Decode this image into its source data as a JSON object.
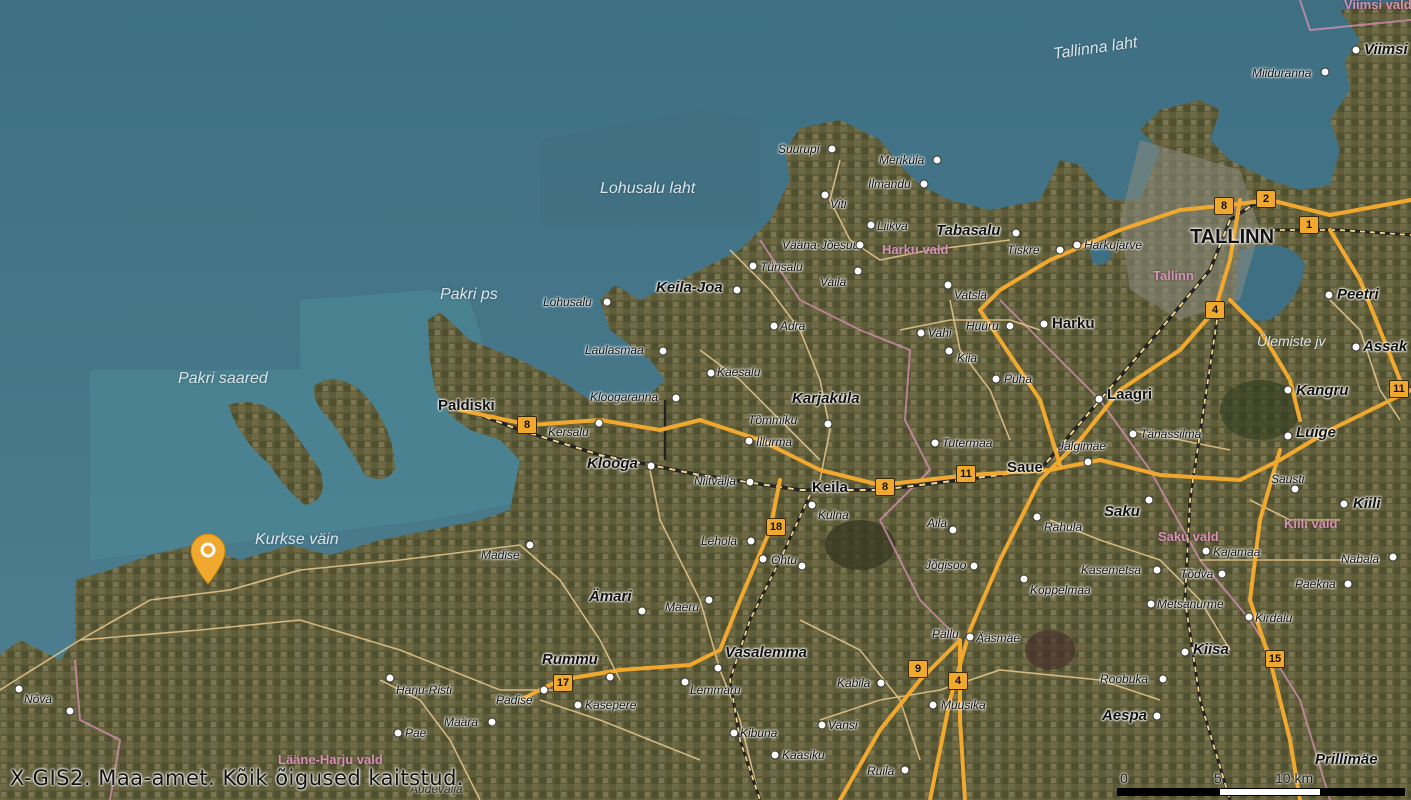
{
  "map": {
    "copyright": "X-GIS2. Maa-amet. Kõik õigused kaitstud.",
    "scale": {
      "labels": [
        "0",
        "5",
        "10 km"
      ]
    },
    "marker": {
      "color": "#f0a92e",
      "icon": "map-pin-icon"
    },
    "colors": {
      "sea": "#3f6d80",
      "land": "#5c5a3a",
      "road": "#f0a92e",
      "parish": "#d790b6"
    },
    "sea_labels": [
      {
        "id": "tallinna-laht",
        "text": "Tallinna laht"
      },
      {
        "id": "lohusalu-laht",
        "text": "Lohusalu laht"
      },
      {
        "id": "pakri-ps",
        "text": "Pakri ps"
      },
      {
        "id": "pakri-saared",
        "text": "Pakri saared"
      },
      {
        "id": "kurkse-vain",
        "text": "Kurkse väin"
      },
      {
        "id": "ulemiste-jv",
        "text": "Ülemiste jv"
      }
    ],
    "parish_labels": [
      {
        "id": "harku-vald",
        "text": "Harku vald"
      },
      {
        "id": "tallinn-area",
        "text": "Tallinn"
      },
      {
        "id": "saku-vald",
        "text": "Saku vald"
      },
      {
        "id": "kiili-vald",
        "text": "Kiili vald"
      },
      {
        "id": "laane-harju-vald",
        "text": "Lääne-Harju vald"
      },
      {
        "id": "viimsi-vald",
        "text": "Viimsi vald"
      }
    ],
    "capital": {
      "id": "tallinn",
      "text": "TALLINN"
    },
    "cities": [
      {
        "id": "paldiski",
        "text": "Paldiski"
      },
      {
        "id": "klooga",
        "text": "Klooga"
      },
      {
        "id": "keila-joa",
        "text": "Keila-Joa"
      },
      {
        "id": "karjakula",
        "text": "Karjaküla"
      },
      {
        "id": "keila",
        "text": "Keila"
      },
      {
        "id": "tabasalu",
        "text": "Tabasalu"
      },
      {
        "id": "harku",
        "text": "Harku"
      },
      {
        "id": "laagri",
        "text": "Laagri"
      },
      {
        "id": "saue",
        "text": "Saue"
      },
      {
        "id": "saku",
        "text": "Saku"
      },
      {
        "id": "kiisa",
        "text": "Kiisa"
      },
      {
        "id": "aespa",
        "text": "Aespa"
      },
      {
        "id": "rummu",
        "text": "Rummu"
      },
      {
        "id": "amari",
        "text": "Ämari"
      },
      {
        "id": "vasalemma",
        "text": "Vasalemma"
      },
      {
        "id": "kangru",
        "text": "Kangru"
      },
      {
        "id": "luige",
        "text": "Luige"
      },
      {
        "id": "kiili",
        "text": "Kiili"
      },
      {
        "id": "peetri",
        "text": "Peetri"
      },
      {
        "id": "assaku",
        "text": "Assak"
      },
      {
        "id": "viimsi",
        "text": "Viimsi"
      },
      {
        "id": "prillimae",
        "text": "Prillimäe"
      }
    ],
    "towns": [
      {
        "id": "suurupi",
        "text": "Suurupi"
      },
      {
        "id": "merikula",
        "text": "Meriküla"
      },
      {
        "id": "ilmandu",
        "text": "Ilmandu"
      },
      {
        "id": "viti",
        "text": "Viti"
      },
      {
        "id": "liikva",
        "text": "Liikva"
      },
      {
        "id": "vaana-joesuu",
        "text": "Vääna-Jõesuu"
      },
      {
        "id": "tiskre",
        "text": "Tiskre"
      },
      {
        "id": "harkujarve",
        "text": "Harkujärve"
      },
      {
        "id": "turisalu",
        "text": "Türisalu"
      },
      {
        "id": "vaila",
        "text": "Vaila"
      },
      {
        "id": "vatsla",
        "text": "Vatsla"
      },
      {
        "id": "lohusalu",
        "text": "Lohusalu"
      },
      {
        "id": "laulasmaa",
        "text": "Laulasmaa"
      },
      {
        "id": "adra",
        "text": "Adra"
      },
      {
        "id": "vahi",
        "text": "Vahi"
      },
      {
        "id": "huuru",
        "text": "Hüüru"
      },
      {
        "id": "kiia",
        "text": "Kiia"
      },
      {
        "id": "kaesalu",
        "text": "Käesalu"
      },
      {
        "id": "puha",
        "text": "Püha"
      },
      {
        "id": "kloogaranna",
        "text": "Kloogaranna"
      },
      {
        "id": "kersalu",
        "text": "Kersalu"
      },
      {
        "id": "tommiku",
        "text": "Tõmmiku"
      },
      {
        "id": "illurma",
        "text": "Illurma"
      },
      {
        "id": "tutermaa",
        "text": "Tutermaa"
      },
      {
        "id": "jalgimae",
        "text": "Jälgimäe"
      },
      {
        "id": "tanassilma",
        "text": "Tänassilma"
      },
      {
        "id": "niitvalja",
        "text": "Niitvälja"
      },
      {
        "id": "kulna",
        "text": "Kulna"
      },
      {
        "id": "aila",
        "text": "Aila"
      },
      {
        "id": "rahula",
        "text": "Rahula"
      },
      {
        "id": "sausti",
        "text": "Sausti"
      },
      {
        "id": "madise",
        "text": "Madise"
      },
      {
        "id": "lehola",
        "text": "Lehola"
      },
      {
        "id": "ohtu",
        "text": "Ohtu"
      },
      {
        "id": "jogisoo",
        "text": "Jõgisoo"
      },
      {
        "id": "kajamaa",
        "text": "Kajamaa"
      },
      {
        "id": "nabala",
        "text": "Nabala"
      },
      {
        "id": "kasemetsa",
        "text": "Kasemetsa"
      },
      {
        "id": "todva",
        "text": "Tõdva"
      },
      {
        "id": "paekna",
        "text": "Paekna"
      },
      {
        "id": "koppelmaa",
        "text": "Koppelmaa"
      },
      {
        "id": "maeru",
        "text": "Maeru"
      },
      {
        "id": "metsanurme",
        "text": "Metsanurme"
      },
      {
        "id": "kirdalu",
        "text": "Kirdalu"
      },
      {
        "id": "pallu",
        "text": "Pällu"
      },
      {
        "id": "aasmae",
        "text": "Ääsmäe"
      },
      {
        "id": "nova",
        "text": "Nõva"
      },
      {
        "id": "harju-risti",
        "text": "Harju-Risti"
      },
      {
        "id": "padise",
        "text": "Padise"
      },
      {
        "id": "kasepere",
        "text": "Kasepere"
      },
      {
        "id": "lemmaru",
        "text": "Lemmaru"
      },
      {
        "id": "kabila",
        "text": "Kabila"
      },
      {
        "id": "roobuka",
        "text": "Roobuka"
      },
      {
        "id": "maara",
        "text": "Määra"
      },
      {
        "id": "muusika",
        "text": "Muusika"
      },
      {
        "id": "pae",
        "text": "Pae"
      },
      {
        "id": "vansi",
        "text": "Vansi"
      },
      {
        "id": "kibuna",
        "text": "Kibuna"
      },
      {
        "id": "kaasiku",
        "text": "Kaasiku"
      },
      {
        "id": "ruila",
        "text": "Ruila"
      },
      {
        "id": "miiduranna",
        "text": "Miiduranna"
      },
      {
        "id": "aude",
        "text": "Audevälja"
      }
    ],
    "road_shields": [
      "8",
      "2",
      "1",
      "4",
      "8",
      "11",
      "8",
      "18",
      "17",
      "9",
      "4",
      "15",
      "11"
    ]
  }
}
